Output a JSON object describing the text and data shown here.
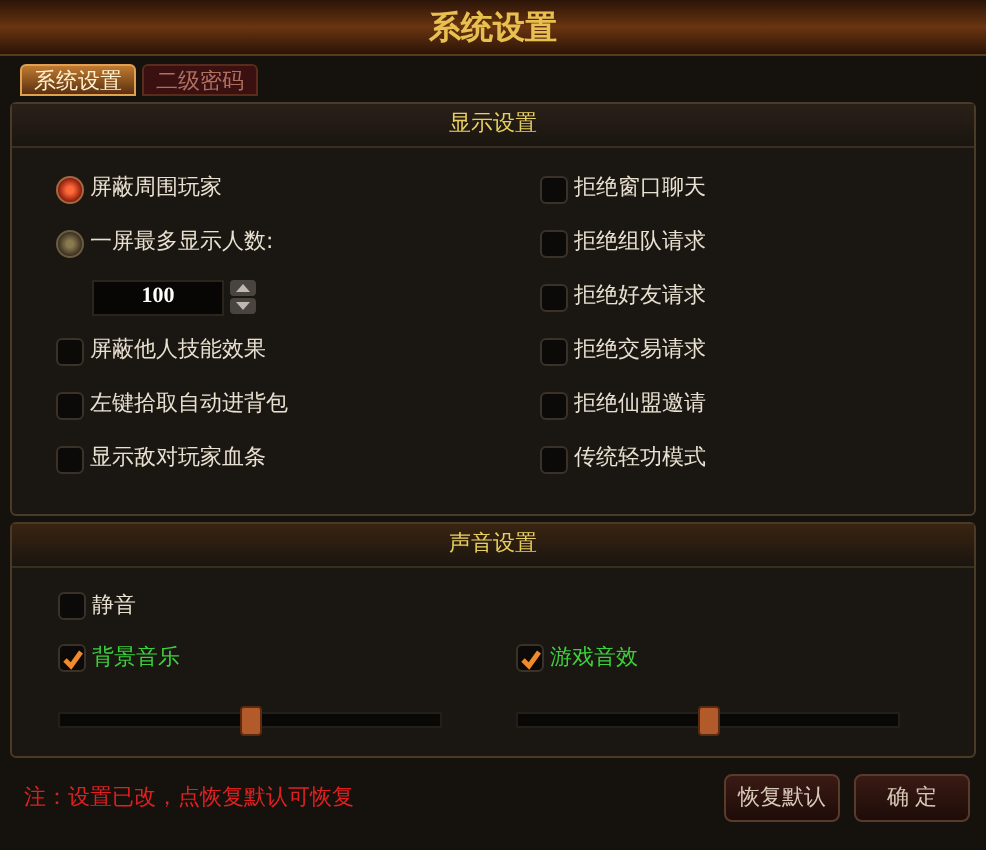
{
  "window": {
    "title": "系统设置"
  },
  "tabs": [
    {
      "label": "系统设置",
      "selected": true
    },
    {
      "label": "二级密码",
      "selected": false
    }
  ],
  "display": {
    "title": "显示设置",
    "left": [
      {
        "kind": "radio",
        "label": "屏蔽周围玩家",
        "selected": true
      },
      {
        "kind": "radio",
        "label": "一屏最多显示人数:",
        "selected": false
      },
      {
        "kind": "stepper",
        "value": "100"
      },
      {
        "kind": "checkbox",
        "label": "屏蔽他人技能效果",
        "checked": false
      },
      {
        "kind": "checkbox",
        "label": "左键拾取自动进背包",
        "checked": false
      },
      {
        "kind": "checkbox",
        "label": "显示敌对玩家血条",
        "checked": false
      }
    ],
    "right": [
      {
        "label": "拒绝窗口聊天",
        "checked": false
      },
      {
        "label": "拒绝组队请求",
        "checked": false
      },
      {
        "label": "拒绝好友请求",
        "checked": false
      },
      {
        "label": "拒绝交易请求",
        "checked": false
      },
      {
        "label": "拒绝仙盟邀请",
        "checked": false
      },
      {
        "label": "传统轻功模式",
        "checked": false
      }
    ]
  },
  "sound": {
    "title": "声音设置",
    "mute": {
      "label": "静音",
      "checked": false
    },
    "channels": [
      {
        "label": "背景音乐",
        "checked": true,
        "level": 0.5
      },
      {
        "label": "游戏音效",
        "checked": true,
        "level": 0.5
      }
    ]
  },
  "note": "注：设置已改，点恢复默认可恢复",
  "buttons": [
    "恢复默认",
    "确 定"
  ]
}
